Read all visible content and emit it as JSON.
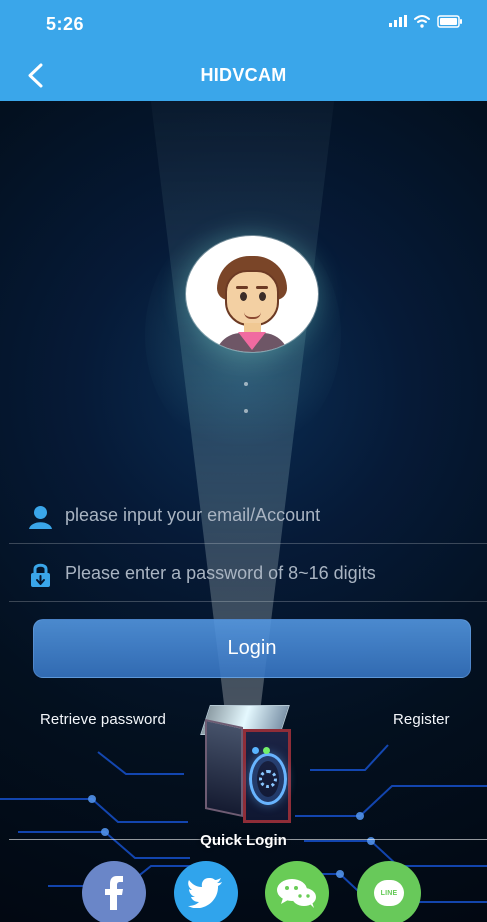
{
  "status_bar": {
    "time": "5:26",
    "icons": [
      "signal-icon",
      "wifi-icon",
      "battery-icon"
    ]
  },
  "nav": {
    "back_icon": "chevron-left-icon",
    "title": "HIDVCAM"
  },
  "profile": {
    "avatar_icon": "user-avatar"
  },
  "login_form": {
    "account_icon": "user-icon",
    "account_placeholder": "please input your email/Account",
    "account_value": "",
    "password_icon": "lock-icon",
    "password_placeholder": "Please enter a password of 8~16 digits",
    "password_value": ""
  },
  "actions": {
    "login_label": "Login",
    "retrieve_password": "Retrieve password",
    "register": "Register"
  },
  "quick_login": {
    "label": "Quick Login",
    "providers": [
      {
        "name": "facebook",
        "icon": "facebook-icon"
      },
      {
        "name": "twitter",
        "icon": "twitter-icon"
      },
      {
        "name": "wechat",
        "icon": "wechat-icon"
      },
      {
        "name": "line",
        "icon": "line-icon",
        "text": "LINE"
      }
    ]
  },
  "colors": {
    "header_blue": "#3aa6ea",
    "background_dark": "#05101f",
    "button_blue": "#559ae5",
    "icon_blue": "#3aa6ea",
    "facebook": "#6a86c8",
    "twitter": "#30a4ec",
    "wechat": "#69cc56",
    "line": "#68c95a"
  }
}
